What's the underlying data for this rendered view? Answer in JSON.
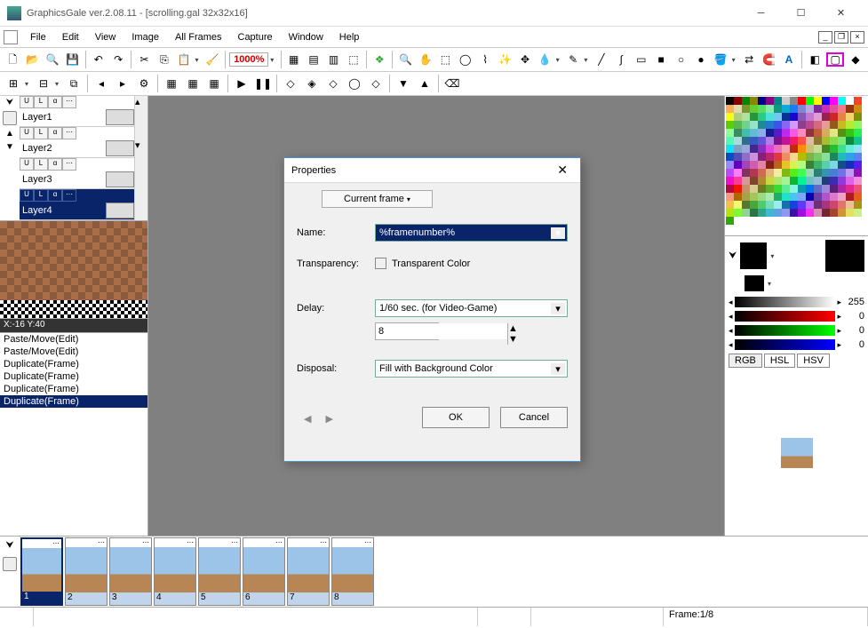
{
  "title": "GraphicsGale ver.2.08.11 - [scrolling.gal 32x32x16]",
  "menu": [
    "File",
    "Edit",
    "View",
    "Image",
    "All Frames",
    "Capture",
    "Window",
    "Help"
  ],
  "zoom": "1000%",
  "layers": [
    {
      "name": "Layer1"
    },
    {
      "name": "Layer2"
    },
    {
      "name": "Layer3"
    },
    {
      "name": "Layer4",
      "selected": true
    }
  ],
  "coord": "X:-16 Y:40",
  "history": [
    "Paste/Move(Edit)",
    "Paste/Move(Edit)",
    "Duplicate(Frame)",
    "Duplicate(Frame)",
    "Duplicate(Frame)",
    "Duplicate(Frame)"
  ],
  "history_selected_index": 5,
  "gray_value": "255",
  "rgb": {
    "r": "0",
    "g": "0",
    "b": "0"
  },
  "color_tabs": [
    "RGB",
    "HSL",
    "HSV"
  ],
  "frames": [
    "1",
    "2",
    "3",
    "4",
    "5",
    "6",
    "7",
    "8"
  ],
  "frame_selected": 0,
  "status_frame": "Frame:1/8",
  "dialog": {
    "title": "Properties",
    "tab": "Current frame",
    "name_label": "Name:",
    "name_value": "%framenumber%",
    "transparency_label": "Transparency:",
    "transparent_color_label": "Transparent Color",
    "delay_label": "Delay:",
    "delay_combo": "1/60 sec. (for Video-Game)",
    "delay_value": "8",
    "disposal_label": "Disposal:",
    "disposal_value": "Fill with Background Color",
    "ok": "OK",
    "cancel": "Cancel"
  }
}
